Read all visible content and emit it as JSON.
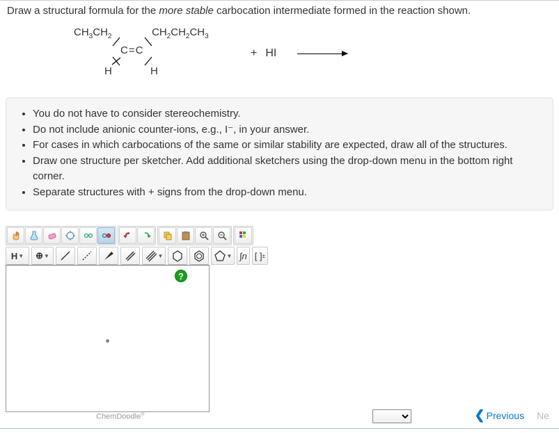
{
  "question": {
    "pre": "Draw a structural formula for the ",
    "em": "more stable",
    "post": " carbocation intermediate formed in the reaction shown."
  },
  "reaction": {
    "left_top_left": "CH₃CH₂",
    "left_top_right": "CH₂CH₂CH₃",
    "center": "C=C",
    "bottom_left": "H",
    "bottom_right": "H",
    "plus": "+",
    "reagent": "HI"
  },
  "hints": [
    "You do not have to consider stereochemistry.",
    "Do not include anionic counter-ions, e.g., I⁻, in your answer.",
    "For cases in which carbocations of the same or similar stability are expected, draw all of the structures.",
    "Draw one structure per sketcher. Add additional sketchers using the drop-down menu in the bottom right corner.",
    "Separate structures with + signs from the drop-down menu."
  ],
  "toolbar": {
    "element": "H",
    "sn_label": "∫n",
    "bracket": "[ ]",
    "bracket_sup": "±"
  },
  "footer": {
    "chemdoodle": "ChemDoodle",
    "reg": "®"
  },
  "nav": {
    "prev": "Previous",
    "next": "Ne"
  },
  "help": "?"
}
